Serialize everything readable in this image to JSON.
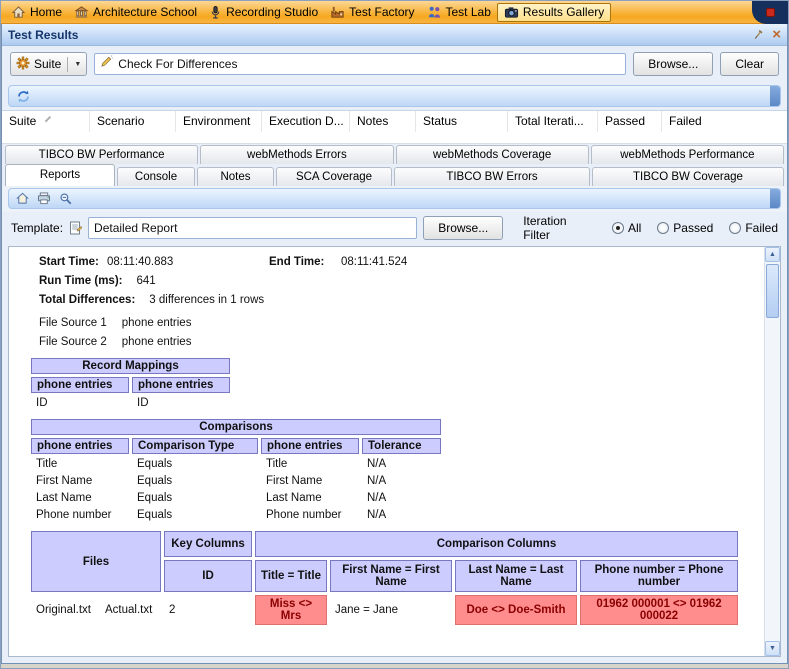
{
  "colors": {
    "header_fill": "#CCCCFF",
    "diff_fill": "#FF8D8D",
    "accent_orange": "#F6A81F",
    "bar_blue": "#BED7F6"
  },
  "icons": {
    "arrow_up": "▲",
    "arrow_down": "▼",
    "caret_down": "▼",
    "close": "×"
  },
  "menu": {
    "items": [
      {
        "label": "Home"
      },
      {
        "label": "Architecture School"
      },
      {
        "label": "Recording Studio"
      },
      {
        "label": "Test Factory"
      },
      {
        "label": "Test Lab"
      },
      {
        "label": "Results Gallery"
      }
    ]
  },
  "panel": {
    "title": "Test Results"
  },
  "suite_bar": {
    "suite_button": "Suite",
    "search_value": "Check For Differences",
    "browse_button": "Browse...",
    "clear_button": "Clear"
  },
  "results_table": {
    "columns": [
      "Suite",
      "Scenario",
      "Environment",
      "Execution D...",
      "Notes",
      "Status",
      "Total Iterati...",
      "Passed",
      "Failed"
    ]
  },
  "tabs": {
    "row1": [
      "TIBCO BW Performance",
      "webMethods Errors",
      "webMethods Coverage",
      "webMethods Performance"
    ],
    "row2": [
      "Reports",
      "Console",
      "Notes",
      "SCA Coverage",
      "TIBCO BW Errors",
      "TIBCO BW Coverage"
    ],
    "active": "Reports"
  },
  "template_bar": {
    "label": "Template:",
    "value": "Detailed Report",
    "browse_button": "Browse...",
    "iteration_filter_label": "Iteration Filter",
    "options": [
      "All",
      "Passed",
      "Failed"
    ],
    "selected": "All"
  },
  "report": {
    "summary": {
      "start_time_label": "Start Time:",
      "start_time": "08:11:40.883",
      "end_time_label": "End Time:",
      "end_time": "08:11:41.524",
      "run_time_label": "Run Time (ms):",
      "run_time": "641",
      "total_differences_label": "Total Differences:",
      "total_differences": "3 differences in 1 rows",
      "file_source_1_label": "File Source 1",
      "file_source_1": "phone entries",
      "file_source_2_label": "File Source 2",
      "file_source_2": "phone entries"
    },
    "record_mappings": {
      "title": "Record Mappings",
      "headers": [
        "phone entries",
        "phone entries"
      ],
      "rows": [
        [
          "ID",
          "ID"
        ]
      ]
    },
    "comparisons": {
      "title": "Comparisons",
      "headers": [
        "phone entries",
        "Comparison Type",
        "phone entries",
        "Tolerance"
      ],
      "rows": [
        [
          "Title",
          "Equals",
          "Title",
          "N/A"
        ],
        [
          "First Name",
          "Equals",
          "First Name",
          "N/A"
        ],
        [
          "Last Name",
          "Equals",
          "Last Name",
          "N/A"
        ],
        [
          "Phone number",
          "Equals",
          "Phone number",
          "N/A"
        ]
      ]
    },
    "files_table": {
      "files_header": "Files",
      "key_columns_header": "Key Columns",
      "comparison_columns_header": "Comparison Columns",
      "key_column": "ID",
      "comparison_headers": [
        "Title = Title",
        "First Name = First Name",
        "Last Name = Last Name",
        "Phone number = Phone number"
      ],
      "row": {
        "file1": "Original.txt",
        "file2": "Actual.txt",
        "key": "2",
        "cells": [
          {
            "text": "Miss <> Mrs",
            "diff": true
          },
          {
            "text": "Jane = Jane",
            "diff": false
          },
          {
            "text": "Doe <> Doe-Smith",
            "diff": true
          },
          {
            "text": "01962 000001 <> 01962 000022",
            "diff": true
          }
        ]
      }
    }
  }
}
